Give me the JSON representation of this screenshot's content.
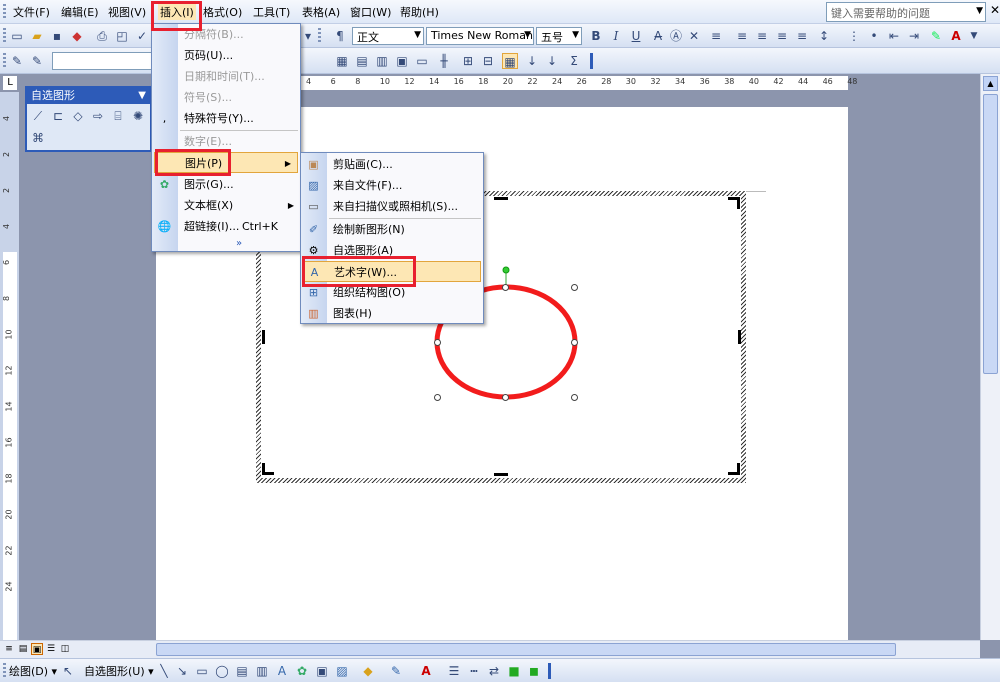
{
  "menubar": {
    "items": [
      "文件(F)",
      "编辑(E)",
      "视图(V)",
      "插入(I)",
      "格式(O)",
      "工具(T)",
      "表格(A)",
      "窗口(W)",
      "帮助(H)"
    ],
    "help_placeholder": "键入需要帮助的问题"
  },
  "format_toolbar": {
    "style": "正文",
    "font": "Times New Roman",
    "size": "五号",
    "bold": "B",
    "italic": "I",
    "underline": "U",
    "font_color": "A"
  },
  "ruler": {
    "h_ticks": [
      "4",
      "6",
      "8",
      "10",
      "12",
      "14",
      "16",
      "18",
      "20",
      "22",
      "24",
      "26",
      "28",
      "30",
      "32",
      "34",
      "36",
      "38",
      "40",
      "42",
      "44",
      "46",
      "48"
    ],
    "v_ticks": [
      "4",
      "2",
      "2",
      "4",
      "6",
      "8",
      "10",
      "12",
      "14",
      "16",
      "18",
      "20",
      "22",
      "24"
    ],
    "corner": "L"
  },
  "autoshape_toolbar": {
    "title": "自选图形"
  },
  "insert_menu": {
    "items": [
      {
        "label": "分隔符(B)...",
        "disabled": true
      },
      {
        "label": "页码(U)...",
        "disabled": false
      },
      {
        "label": "日期和时间(T)...",
        "disabled": true
      },
      {
        "label": "符号(S)...",
        "disabled": true
      },
      {
        "label": "特殊符号(Y)...",
        "disabled": false
      },
      {
        "label": "数字(E)...",
        "disabled": true
      },
      {
        "label": "图片(P)",
        "disabled": false,
        "highlighted": true
      },
      {
        "label": "图示(G)...",
        "disabled": false
      },
      {
        "label": "文本框(X)",
        "disabled": false
      },
      {
        "label": "超链接(I)...",
        "disabled": false,
        "shortcut": "Ctrl+K"
      }
    ],
    "expand": "»"
  },
  "picture_submenu": {
    "items": [
      {
        "label": "剪贴画(C)..."
      },
      {
        "label": "来自文件(F)..."
      },
      {
        "label": "来自扫描仪或照相机(S)..."
      },
      {
        "label": "绘制新图形(N)"
      },
      {
        "label": "自选图形(A)"
      },
      {
        "label": "艺术字(W)...",
        "highlighted": true
      },
      {
        "label": "组织结构图(O)"
      },
      {
        "label": "图表(H)"
      }
    ]
  },
  "drawing_toolbar": {
    "draw": "绘图(D)",
    "autoshapes": "自选图形(U)"
  },
  "colors": {
    "highlight_red": "#e8202f",
    "ellipse_red": "#f21c1c",
    "menu_highlight": "#fde7b4",
    "title_blue": "#2d5bb8"
  }
}
